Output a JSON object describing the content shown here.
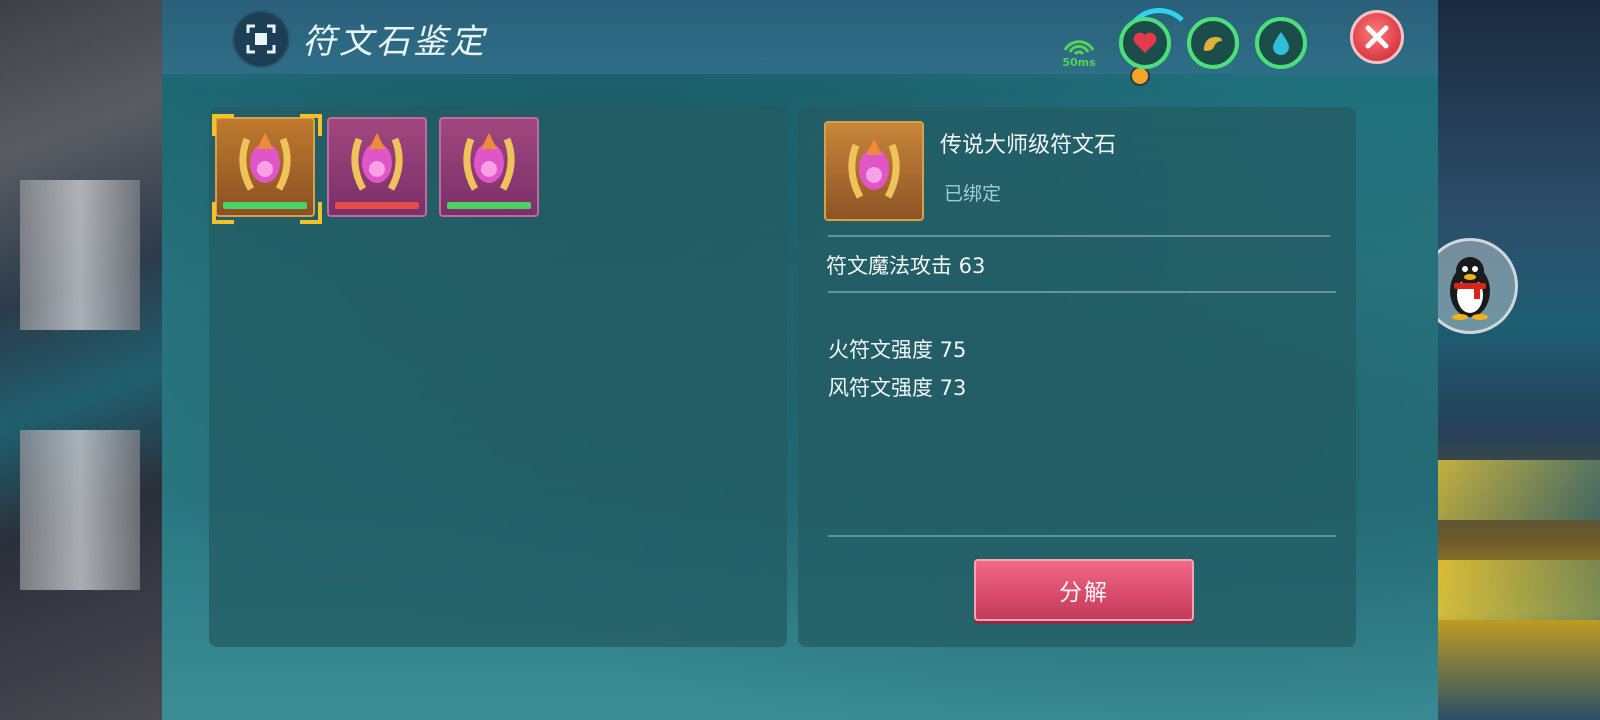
{
  "header": {
    "title": "符文石鉴定",
    "ping": "50ms",
    "stats": [
      {
        "name": "health",
        "icon": "heart-icon",
        "color": "#e63a4a"
      },
      {
        "name": "hunger",
        "icon": "food-icon",
        "color": "#e0b03a"
      },
      {
        "name": "water",
        "icon": "water-drop-icon",
        "color": "#2fc0d8"
      }
    ]
  },
  "inventory": {
    "slots": [
      {
        "rarity": "orange",
        "bar": "green",
        "selected": true
      },
      {
        "rarity": "purple",
        "bar": "red",
        "selected": false
      },
      {
        "rarity": "purple",
        "bar": "green",
        "selected": false
      }
    ]
  },
  "detail": {
    "name": "传说大师级符文石",
    "bound": "已绑定",
    "attack": "符文魔法攻击 63",
    "attributes": [
      "火符文强度 75",
      "风符文强度 73"
    ],
    "decompose_label": "分解"
  },
  "colors": {
    "accent_green": "#4de07a",
    "close_red": "#d93a44",
    "button_pink": "#d94c6c",
    "selection_gold": "#f5c12b"
  }
}
